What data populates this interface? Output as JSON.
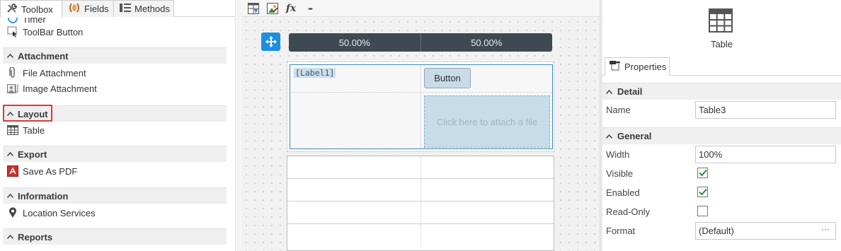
{
  "left_panel": {
    "tabs": [
      {
        "label": "Toolbox",
        "icon": "tools-icon"
      },
      {
        "label": "Fields",
        "icon": "fields-icon"
      },
      {
        "label": "Methods",
        "icon": "methods-icon"
      }
    ],
    "partial_top_item": "Timer",
    "toolbar_button_item": "ToolBar Button",
    "categories": [
      {
        "name": "Attachment",
        "items": [
          "File Attachment",
          "Image Attachment"
        ]
      },
      {
        "name": "Layout",
        "items": [
          "Table"
        ]
      },
      {
        "name": "Export",
        "items": [
          "Save As PDF"
        ]
      },
      {
        "name": "Information",
        "items": [
          "Location Services"
        ]
      },
      {
        "name": "Reports",
        "items": []
      }
    ]
  },
  "canvas": {
    "toolbar_icons": [
      "table-layout-icon",
      "image-edit-icon",
      "expression-icon",
      "more-icon"
    ],
    "expression_glyph": "fx",
    "more_glyph": "▪▪▪",
    "column_widths": [
      "50.00%",
      "50.00%"
    ],
    "label_control": "[Label1]",
    "button_control": "Button",
    "attachment_placeholder": "Click here to attach a file"
  },
  "properties": {
    "control_type": "Table",
    "tab_label": "Properties",
    "sections": {
      "detail": "Detail",
      "general": "General"
    },
    "fields": {
      "name": {
        "label": "Name",
        "value": "Table3"
      },
      "width": {
        "label": "Width",
        "value": "100%"
      },
      "visible": {
        "label": "Visible",
        "checked": true
      },
      "enabled": {
        "label": "Enabled",
        "checked": true
      },
      "read_only": {
        "label": "Read-Only",
        "checked": false
      },
      "format": {
        "label": "Format",
        "value": "(Default)",
        "button": "···"
      }
    }
  },
  "colors": {
    "highlight_border": "#e0383b",
    "move_handle": "#1e8fdf",
    "column_header": "#3e4a52",
    "checkbox_check": "#2e8b3a"
  }
}
